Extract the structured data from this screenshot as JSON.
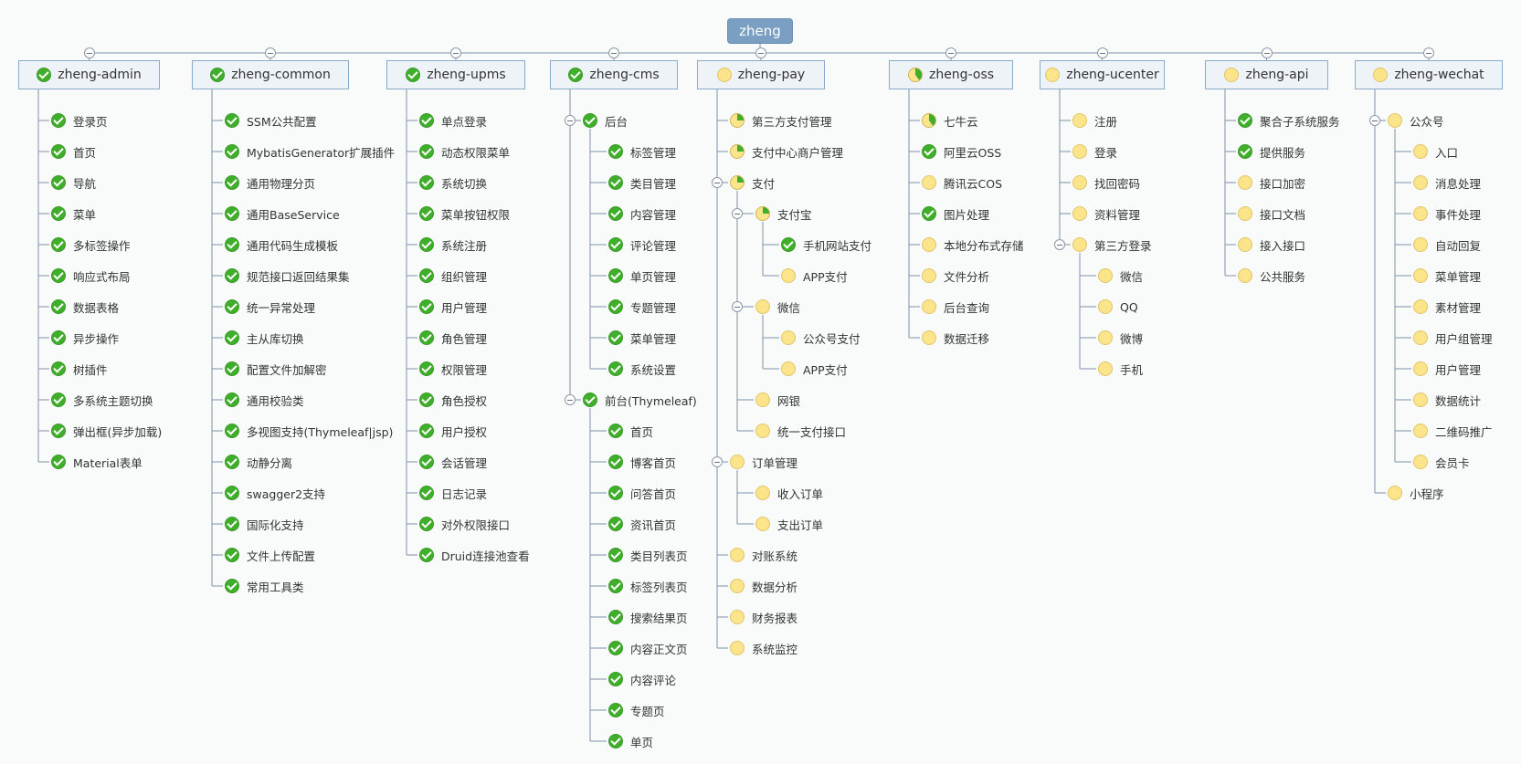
{
  "root": "zheng",
  "modules": [
    {
      "label": "zheng-admin",
      "status": "done",
      "items": [
        {
          "label": "登录页",
          "status": "done"
        },
        {
          "label": "首页",
          "status": "done"
        },
        {
          "label": "导航",
          "status": "done"
        },
        {
          "label": "菜单",
          "status": "done"
        },
        {
          "label": "多标签操作",
          "status": "done"
        },
        {
          "label": "响应式布局",
          "status": "done"
        },
        {
          "label": "数据表格",
          "status": "done"
        },
        {
          "label": "异步操作",
          "status": "done"
        },
        {
          "label": "树插件",
          "status": "done"
        },
        {
          "label": "多系统主题切换",
          "status": "done"
        },
        {
          "label": "弹出框(异步加载)",
          "status": "done"
        },
        {
          "label": "Material表单",
          "status": "done"
        }
      ]
    },
    {
      "label": "zheng-common",
      "status": "done",
      "items": [
        {
          "label": "SSM公共配置",
          "status": "done"
        },
        {
          "label": "MybatisGenerator扩展插件",
          "status": "done"
        },
        {
          "label": "通用物理分页",
          "status": "done"
        },
        {
          "label": "通用BaseService",
          "status": "done"
        },
        {
          "label": "通用代码生成模板",
          "status": "done"
        },
        {
          "label": "规范接口返回结果集",
          "status": "done"
        },
        {
          "label": "统一异常处理",
          "status": "done"
        },
        {
          "label": "主从库切换",
          "status": "done"
        },
        {
          "label": "配置文件加解密",
          "status": "done"
        },
        {
          "label": "通用校验类",
          "status": "done"
        },
        {
          "label": "多视图支持(Thymeleaf|jsp)",
          "status": "done"
        },
        {
          "label": "动静分离",
          "status": "done"
        },
        {
          "label": "swagger2支持",
          "status": "done"
        },
        {
          "label": "国际化支持",
          "status": "done"
        },
        {
          "label": "文件上传配置",
          "status": "done"
        },
        {
          "label": "常用工具类",
          "status": "done"
        }
      ]
    },
    {
      "label": "zheng-upms",
      "status": "done",
      "items": [
        {
          "label": "单点登录",
          "status": "done"
        },
        {
          "label": "动态权限菜单",
          "status": "done"
        },
        {
          "label": "系统切换",
          "status": "done"
        },
        {
          "label": "菜单按钮权限",
          "status": "done"
        },
        {
          "label": "系统注册",
          "status": "done"
        },
        {
          "label": "组织管理",
          "status": "done"
        },
        {
          "label": "用户管理",
          "status": "done"
        },
        {
          "label": "角色管理",
          "status": "done"
        },
        {
          "label": "权限管理",
          "status": "done"
        },
        {
          "label": "角色授权",
          "status": "done"
        },
        {
          "label": "用户授权",
          "status": "done"
        },
        {
          "label": "会话管理",
          "status": "done"
        },
        {
          "label": "日志记录",
          "status": "done"
        },
        {
          "label": "对外权限接口",
          "status": "done"
        },
        {
          "label": "Druid连接池查看",
          "status": "done"
        }
      ]
    },
    {
      "label": "zheng-cms",
      "status": "done",
      "items": [
        {
          "label": "后台",
          "status": "done",
          "children": [
            {
              "label": "标签管理",
              "status": "done"
            },
            {
              "label": "类目管理",
              "status": "done"
            },
            {
              "label": "内容管理",
              "status": "done"
            },
            {
              "label": "评论管理",
              "status": "done"
            },
            {
              "label": "单页管理",
              "status": "done"
            },
            {
              "label": "专题管理",
              "status": "done"
            },
            {
              "label": "菜单管理",
              "status": "done"
            },
            {
              "label": "系统设置",
              "status": "done"
            }
          ]
        },
        {
          "label": "前台(Thymeleaf)",
          "status": "done",
          "children": [
            {
              "label": "首页",
              "status": "done"
            },
            {
              "label": "博客首页",
              "status": "done"
            },
            {
              "label": "问答首页",
              "status": "done"
            },
            {
              "label": "资讯首页",
              "status": "done"
            },
            {
              "label": "类目列表页",
              "status": "done"
            },
            {
              "label": "标签列表页",
              "status": "done"
            },
            {
              "label": "搜索结果页",
              "status": "done"
            },
            {
              "label": "内容正文页",
              "status": "done"
            },
            {
              "label": "内容评论",
              "status": "done"
            },
            {
              "label": "专题页",
              "status": "done"
            },
            {
              "label": "单页",
              "status": "done"
            }
          ]
        }
      ]
    },
    {
      "label": "zheng-pay",
      "status": "todo",
      "items": [
        {
          "label": "第三方支付管理",
          "status": "part"
        },
        {
          "label": "支付中心商户管理",
          "status": "part"
        },
        {
          "label": "支付",
          "status": "part",
          "children": [
            {
              "label": "支付宝",
              "status": "part",
              "children": [
                {
                  "label": "手机网站支付",
                  "status": "done"
                },
                {
                  "label": "APP支付",
                  "status": "todo"
                }
              ]
            },
            {
              "label": "微信",
              "status": "todo",
              "children": [
                {
                  "label": "公众号支付",
                  "status": "todo"
                },
                {
                  "label": "APP支付",
                  "status": "todo"
                }
              ]
            },
            {
              "label": "网银",
              "status": "todo"
            },
            {
              "label": "统一支付接口",
              "status": "todo"
            }
          ]
        },
        {
          "label": "订单管理",
          "status": "todo",
          "children": [
            {
              "label": "收入订单",
              "status": "todo"
            },
            {
              "label": "支出订单",
              "status": "todo"
            }
          ]
        },
        {
          "label": "对账系统",
          "status": "todo"
        },
        {
          "label": "数据分析",
          "status": "todo"
        },
        {
          "label": "财务报表",
          "status": "todo"
        },
        {
          "label": "系统监控",
          "status": "todo"
        }
      ]
    },
    {
      "label": "zheng-oss",
      "status": "part2",
      "items": [
        {
          "label": "七牛云",
          "status": "part2"
        },
        {
          "label": "阿里云OSS",
          "status": "done"
        },
        {
          "label": "腾讯云COS",
          "status": "todo"
        },
        {
          "label": "图片处理",
          "status": "done"
        },
        {
          "label": "本地分布式存储",
          "status": "todo"
        },
        {
          "label": "文件分析",
          "status": "todo"
        },
        {
          "label": "后台查询",
          "status": "todo"
        },
        {
          "label": "数据迁移",
          "status": "todo"
        }
      ]
    },
    {
      "label": "zheng-ucenter",
      "status": "todo",
      "items": [
        {
          "label": "注册",
          "status": "todo"
        },
        {
          "label": "登录",
          "status": "todo"
        },
        {
          "label": "找回密码",
          "status": "todo"
        },
        {
          "label": "资料管理",
          "status": "todo"
        },
        {
          "label": "第三方登录",
          "status": "todo",
          "children": [
            {
              "label": "微信",
              "status": "todo"
            },
            {
              "label": "QQ",
              "status": "todo"
            },
            {
              "label": "微博",
              "status": "todo"
            },
            {
              "label": "手机",
              "status": "todo"
            }
          ]
        }
      ]
    },
    {
      "label": "zheng-api",
      "status": "todo",
      "items": [
        {
          "label": "聚合子系统服务",
          "status": "done"
        },
        {
          "label": "提供服务",
          "status": "done"
        },
        {
          "label": "接口加密",
          "status": "todo"
        },
        {
          "label": "接口文档",
          "status": "todo"
        },
        {
          "label": "接入接口",
          "status": "todo"
        },
        {
          "label": "公共服务",
          "status": "todo"
        }
      ]
    },
    {
      "label": "zheng-wechat",
      "status": "todo",
      "items": [
        {
          "label": "公众号",
          "status": "todo",
          "children": [
            {
              "label": "入口",
              "status": "todo"
            },
            {
              "label": "消息处理",
              "status": "todo"
            },
            {
              "label": "事件处理",
              "status": "todo"
            },
            {
              "label": "自动回复",
              "status": "todo"
            },
            {
              "label": "菜单管理",
              "status": "todo"
            },
            {
              "label": "素材管理",
              "status": "todo"
            },
            {
              "label": "用户组管理",
              "status": "todo"
            },
            {
              "label": "用户管理",
              "status": "todo"
            },
            {
              "label": "数据统计",
              "status": "todo"
            },
            {
              "label": "二维码推广",
              "status": "todo"
            },
            {
              "label": "会员卡",
              "status": "todo"
            }
          ]
        },
        {
          "label": "小程序",
          "status": "todo"
        }
      ]
    }
  ]
}
